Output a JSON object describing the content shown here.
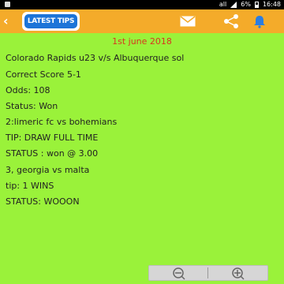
{
  "status_bar": {
    "signal_text": "all",
    "battery": "6%",
    "time": "16:48"
  },
  "toolbar": {
    "logo_text": "LATEST TIPS",
    "colors": {
      "bar": "#f4ab2a",
      "logo": "#1d74d8"
    }
  },
  "content": {
    "date": "1st june 2018",
    "lines": [
      "Colorado Rapids u23 v/s Albuquerque sol",
      "Correct Score 5-1",
      "Odds: 108",
      "Status: Won",
      "2:limeric fc vs bohemians",
      "TIP:  DRAW FULL TIME",
      "STATUS : won @ 3.00",
      "3, georgia vs malta",
      "tip: 1 WINS",
      "STATUS: WOOON"
    ]
  },
  "icons": {
    "back": "back-arrow-icon",
    "mail": "mail-icon",
    "share": "share-icon",
    "bell": "bell-icon",
    "zoom_out": "zoom-out-icon",
    "zoom_in": "zoom-in-icon"
  }
}
